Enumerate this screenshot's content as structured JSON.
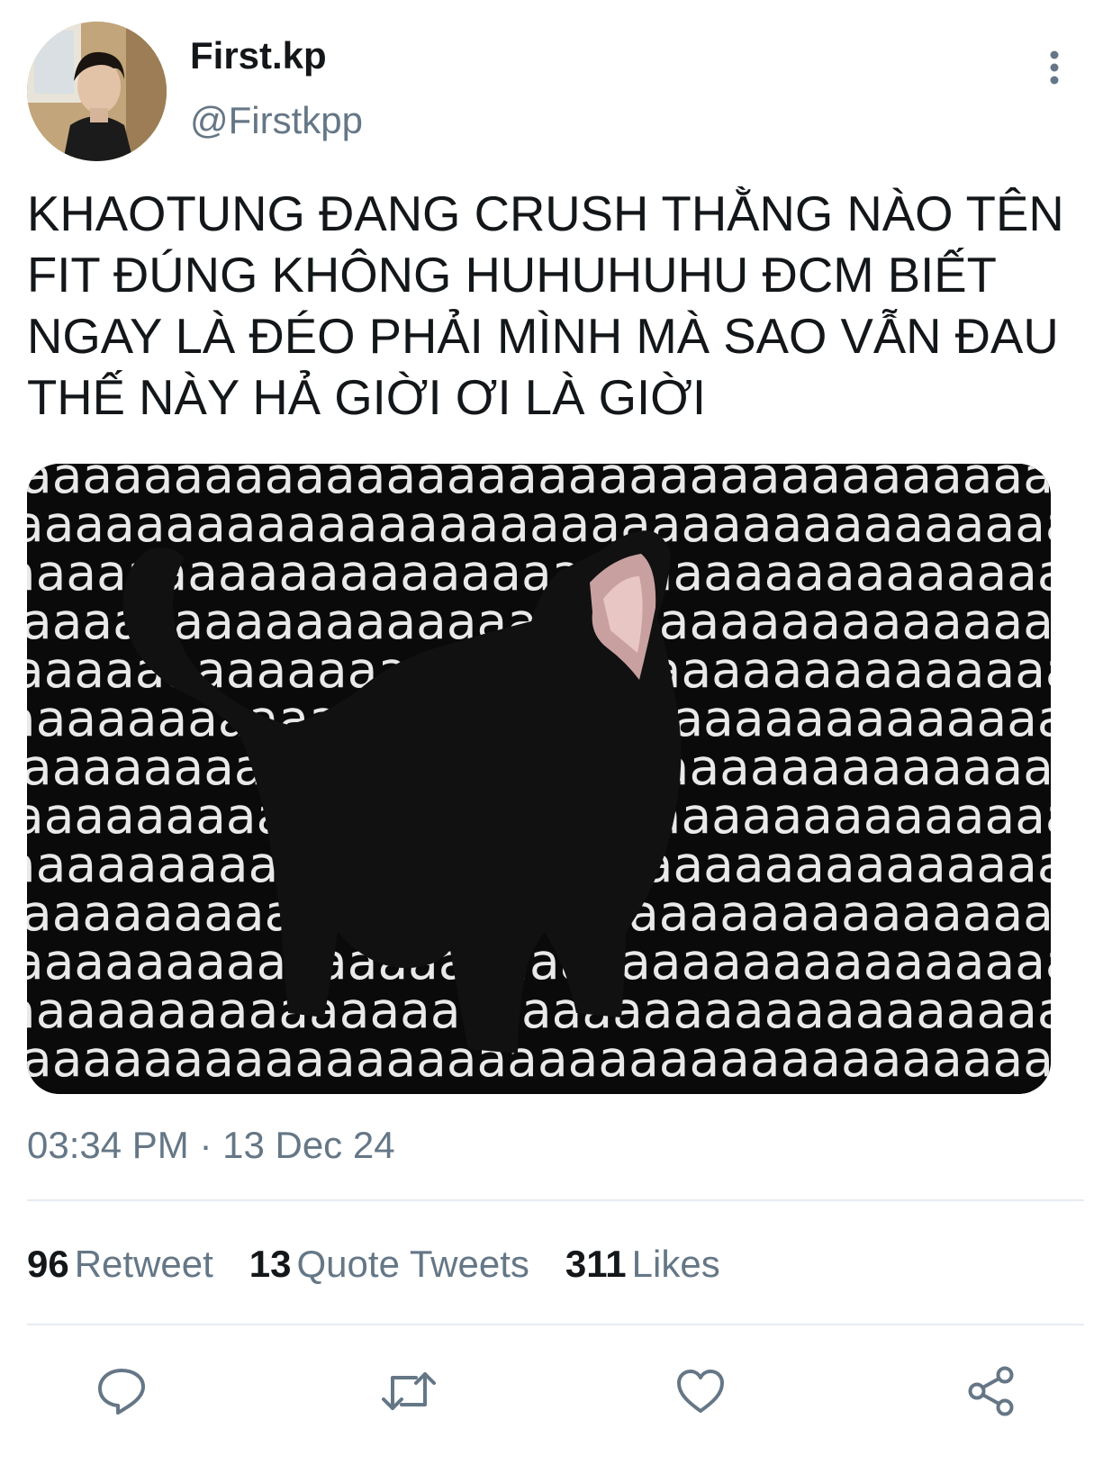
{
  "author": {
    "display_name": "First.kp",
    "handle": "@Firstkpp",
    "avatar_icon": "profile-photo"
  },
  "menu": {
    "icon": "more-vertical-icon"
  },
  "tweet": {
    "text": "KHAOTUNG ĐANG CRUSH THẰNG NÀO TÊN\nFIT ĐÚNG KHÔNG HUHUHUHU ĐCM BIẾT\nNGAY LÀ ĐÉO PHẢI MÌNH MÀ SAO VẪN ĐAU\nTHẾ NÀY HẢ GIỜI ƠI LÀ GIỜI",
    "media": {
      "description_icon": "black-cat-screaming-image",
      "background_glyph": "a"
    },
    "timestamp": "03:34 PM · 13 Dec 24"
  },
  "stats": {
    "retweets": {
      "count": "96",
      "label": "Retweet"
    },
    "quotes": {
      "count": "13",
      "label": "Quote Tweets"
    },
    "likes": {
      "count": "311",
      "label": "Likes"
    }
  },
  "actions": [
    {
      "name": "reply",
      "icon": "reply-icon"
    },
    {
      "name": "retweet",
      "icon": "retweet-icon"
    },
    {
      "name": "like",
      "icon": "heart-icon"
    },
    {
      "name": "share",
      "icon": "share-icon"
    }
  ],
  "colors": {
    "text_primary": "#14171a",
    "text_secondary": "#657786",
    "divider": "#e6ecf0",
    "icon": "#657786"
  }
}
